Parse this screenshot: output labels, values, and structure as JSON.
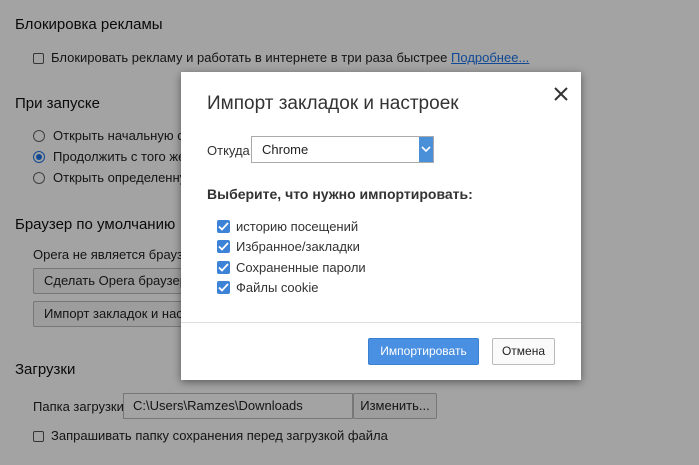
{
  "settings": {
    "ad_block": {
      "title": "Блокировка рекламы",
      "checkbox_label": "Блокировать рекламу и работать в интернете в три раза быстрее",
      "more_link": "Подробнее..."
    },
    "startup": {
      "title": "При запуске",
      "options": [
        {
          "label": "Открыть начальную стр",
          "selected": false
        },
        {
          "label": "Продолжить с того же м",
          "selected": true
        },
        {
          "label": "Открыть определенную",
          "selected": false
        }
      ]
    },
    "default_browser": {
      "title": "Браузер по умолчанию",
      "status": "Opera не является браузер",
      "make_default_button": "Сделать Opera браузеро",
      "import_button": "Импорт закладок и настр"
    },
    "downloads": {
      "title": "Загрузки",
      "folder_label": "Папка загрузки:",
      "folder_path": "C:\\Users\\Ramzes\\Downloads",
      "change_button": "Изменить...",
      "ask_label": "Запрашивать папку сохранения перед загрузкой файла"
    }
  },
  "dialog": {
    "title": "Импорт закладок и настроек",
    "from_label": "Откуда:",
    "from_value": "Chrome",
    "subtitle": "Выберите, что нужно импортировать:",
    "options": [
      {
        "label": "историю посещений",
        "checked": true
      },
      {
        "label": "Избранное/закладки",
        "checked": true
      },
      {
        "label": "Сохраненные пароли",
        "checked": true
      },
      {
        "label": "Файлы cookie",
        "checked": true
      }
    ],
    "import_button": "Импортировать",
    "cancel_button": "Отмена"
  },
  "colors": {
    "accent": "#4a90e2",
    "checkbox": "#3c82d6",
    "link": "#1a73e8"
  }
}
